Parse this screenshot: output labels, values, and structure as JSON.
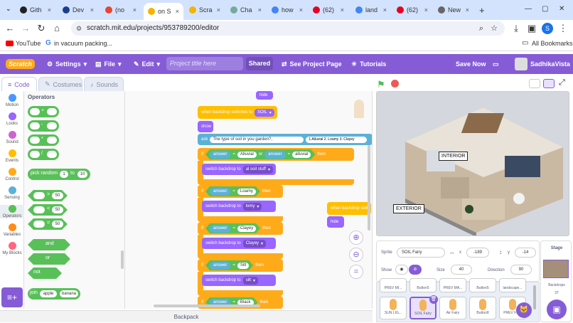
{
  "browser": {
    "tabs": [
      {
        "label": "Gith",
        "color": "#222"
      },
      {
        "label": "Dev",
        "color": "#1a3d8f"
      },
      {
        "label": "(no",
        "color": "#ea4335"
      },
      {
        "label": "on S",
        "color": "#f4b400",
        "active": true
      },
      {
        "label": "Scra",
        "color": "#f4b400"
      },
      {
        "label": "Cha",
        "color": "#74aa9c"
      },
      {
        "label": "how",
        "color": "#4285f4"
      },
      {
        "label": "(62)",
        "color": "#e60023"
      },
      {
        "label": "land",
        "color": "#4285f4"
      },
      {
        "label": "(62)",
        "color": "#e60023"
      },
      {
        "label": "New",
        "color": "#666"
      }
    ],
    "new_tab": "+",
    "url": "scratch.mit.edu/projects/953789200/editor",
    "bookmarks": [
      "YouTube",
      "in vacuum packing..."
    ],
    "all_bookmarks": "All Bookmarks",
    "profile_initial": "S"
  },
  "menu": {
    "logo": "Scratch",
    "settings": "Settings",
    "file": "File",
    "edit": "Edit",
    "title_placeholder": "Project title here",
    "shared": "Shared",
    "see_project": "See Project Page",
    "tutorials": "Tutorials",
    "save_now": "Save Now",
    "username": "SadhikaVista"
  },
  "editor_tabs": [
    "Code",
    "Costumes",
    "Sounds"
  ],
  "categories": [
    {
      "label": "Motion",
      "color": "#4c97ff"
    },
    {
      "label": "Looks",
      "color": "#9966ff"
    },
    {
      "label": "Sound",
      "color": "#cf63cf"
    },
    {
      "label": "Events",
      "color": "#ffbf00"
    },
    {
      "label": "Control",
      "color": "#ffab19"
    },
    {
      "label": "Sensing",
      "color": "#5cb1d6"
    },
    {
      "label": "Operators",
      "color": "#59c059"
    },
    {
      "label": "Variables",
      "color": "#ff8c1a"
    },
    {
      "label": "My Blocks",
      "color": "#ff6680"
    }
  ],
  "palette": {
    "heading": "Operators",
    "ops": [
      "+",
      "-",
      "*",
      "/"
    ],
    "pick_random": "pick random",
    "pick_from": "1",
    "pick_to": "to",
    "pick_to_val": "10",
    "cmp": [
      ">",
      "<",
      "="
    ],
    "cmp_val": "50",
    "and": "and",
    "or": "or",
    "not": "not",
    "join": "join",
    "join_a": "apple",
    "join_b": "banana"
  },
  "script": {
    "hide_top": "hide",
    "backdrop_switch": "when backdrop switches to",
    "backdrop_val": "SOIL",
    "show": "show",
    "ask": "ask",
    "ask_text": "The type of soil in you garden?,",
    "ask_options": "1.Alluvial  2. Loamy  3. Clayey",
    "if": "if",
    "then": "then",
    "answer": "answer",
    "eq": "=",
    "or": "or",
    "alluvial1": "Alluvial",
    "alluvial2": "alluvial",
    "switch_backdrop": "switch backdrop to",
    "bd_alluvial": "al soil stuff",
    "loamy": "Loamy",
    "bd_loamy": "lomy",
    "clayey": "Clayey",
    "bd_clayey": "Clayey",
    "silt": "Silt",
    "bd_silt": "silt",
    "black": "Black",
    "side_event": "when backdrop switc",
    "side_hide": "hide"
  },
  "backpack": "Backpack",
  "stage": {
    "interior": "INTERIOR",
    "exterior": "EXTERIOR"
  },
  "sprite_info": {
    "sprite_label": "Sprite",
    "sprite_name": "SOIL Fairy",
    "x_label": "x",
    "x": "-189",
    "y_label": "y",
    "y": "-14",
    "show": "Show",
    "size_label": "Size",
    "size": "40",
    "direction_label": "Direction",
    "direction": "90"
  },
  "sprites_row1": [
    "PREV MI...",
    "Button5",
    "PREV MA...",
    "Button5",
    "landscape..."
  ],
  "sprites_row2": [
    "SUN LIG...",
    "SOIL Fairy",
    "Air Fairy",
    "Button8",
    "PREV FOR"
  ],
  "stage_panel": {
    "title": "Stage",
    "backdrops_label": "Backdrops",
    "backdrops_count": "37"
  }
}
